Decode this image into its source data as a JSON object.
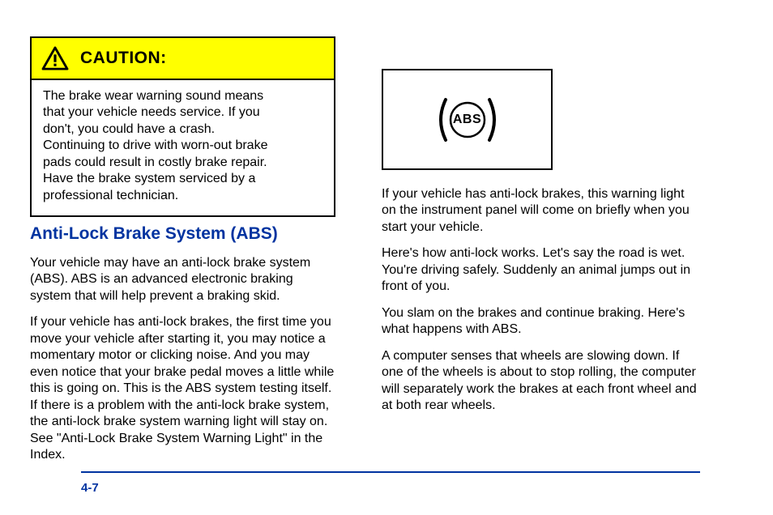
{
  "caution": {
    "label": "CAUTION:",
    "body_lines": [
      "The brake wear warning sound means",
      "that your vehicle needs service. If you",
      "don't, you could have a crash.",
      "Continuing to drive with worn-out brake",
      "pads could result in costly brake repair.",
      "Have the brake system serviced by a",
      "professional technician."
    ]
  },
  "left": {
    "heading": "Anti-Lock Brake System (ABS)",
    "p1": "Your vehicle may have an anti-lock brake system (ABS). ABS is an advanced electronic braking system that will help prevent a braking skid.",
    "p2": "If your vehicle has anti-lock brakes, the first time you move your vehicle after starting it, you may notice a momentary motor or clicking noise. And you may even notice that your brake pedal moves a little while this is going on. This is the ABS system testing itself. If there is a problem with the anti-lock brake system, the anti-lock brake system warning light will stay on. See \"Anti-Lock Brake System Warning Light\" in the Index."
  },
  "abs": {
    "label": "ABS"
  },
  "right": {
    "p1": "If your vehicle has anti-lock brakes, this warning light on the instrument panel will come on briefly when you start your vehicle.",
    "p2": "Here's how anti-lock works. Let's say the road is wet. You're driving safely. Suddenly an animal jumps out in front of you.",
    "p3": "You slam on the brakes and continue braking. Here's what happens with ABS.",
    "p4": "A computer senses that wheels are slowing down. If one of the wheels is about to stop rolling, the computer will separately work the brakes at each front wheel and at both rear wheels."
  },
  "page_number": "4-7"
}
